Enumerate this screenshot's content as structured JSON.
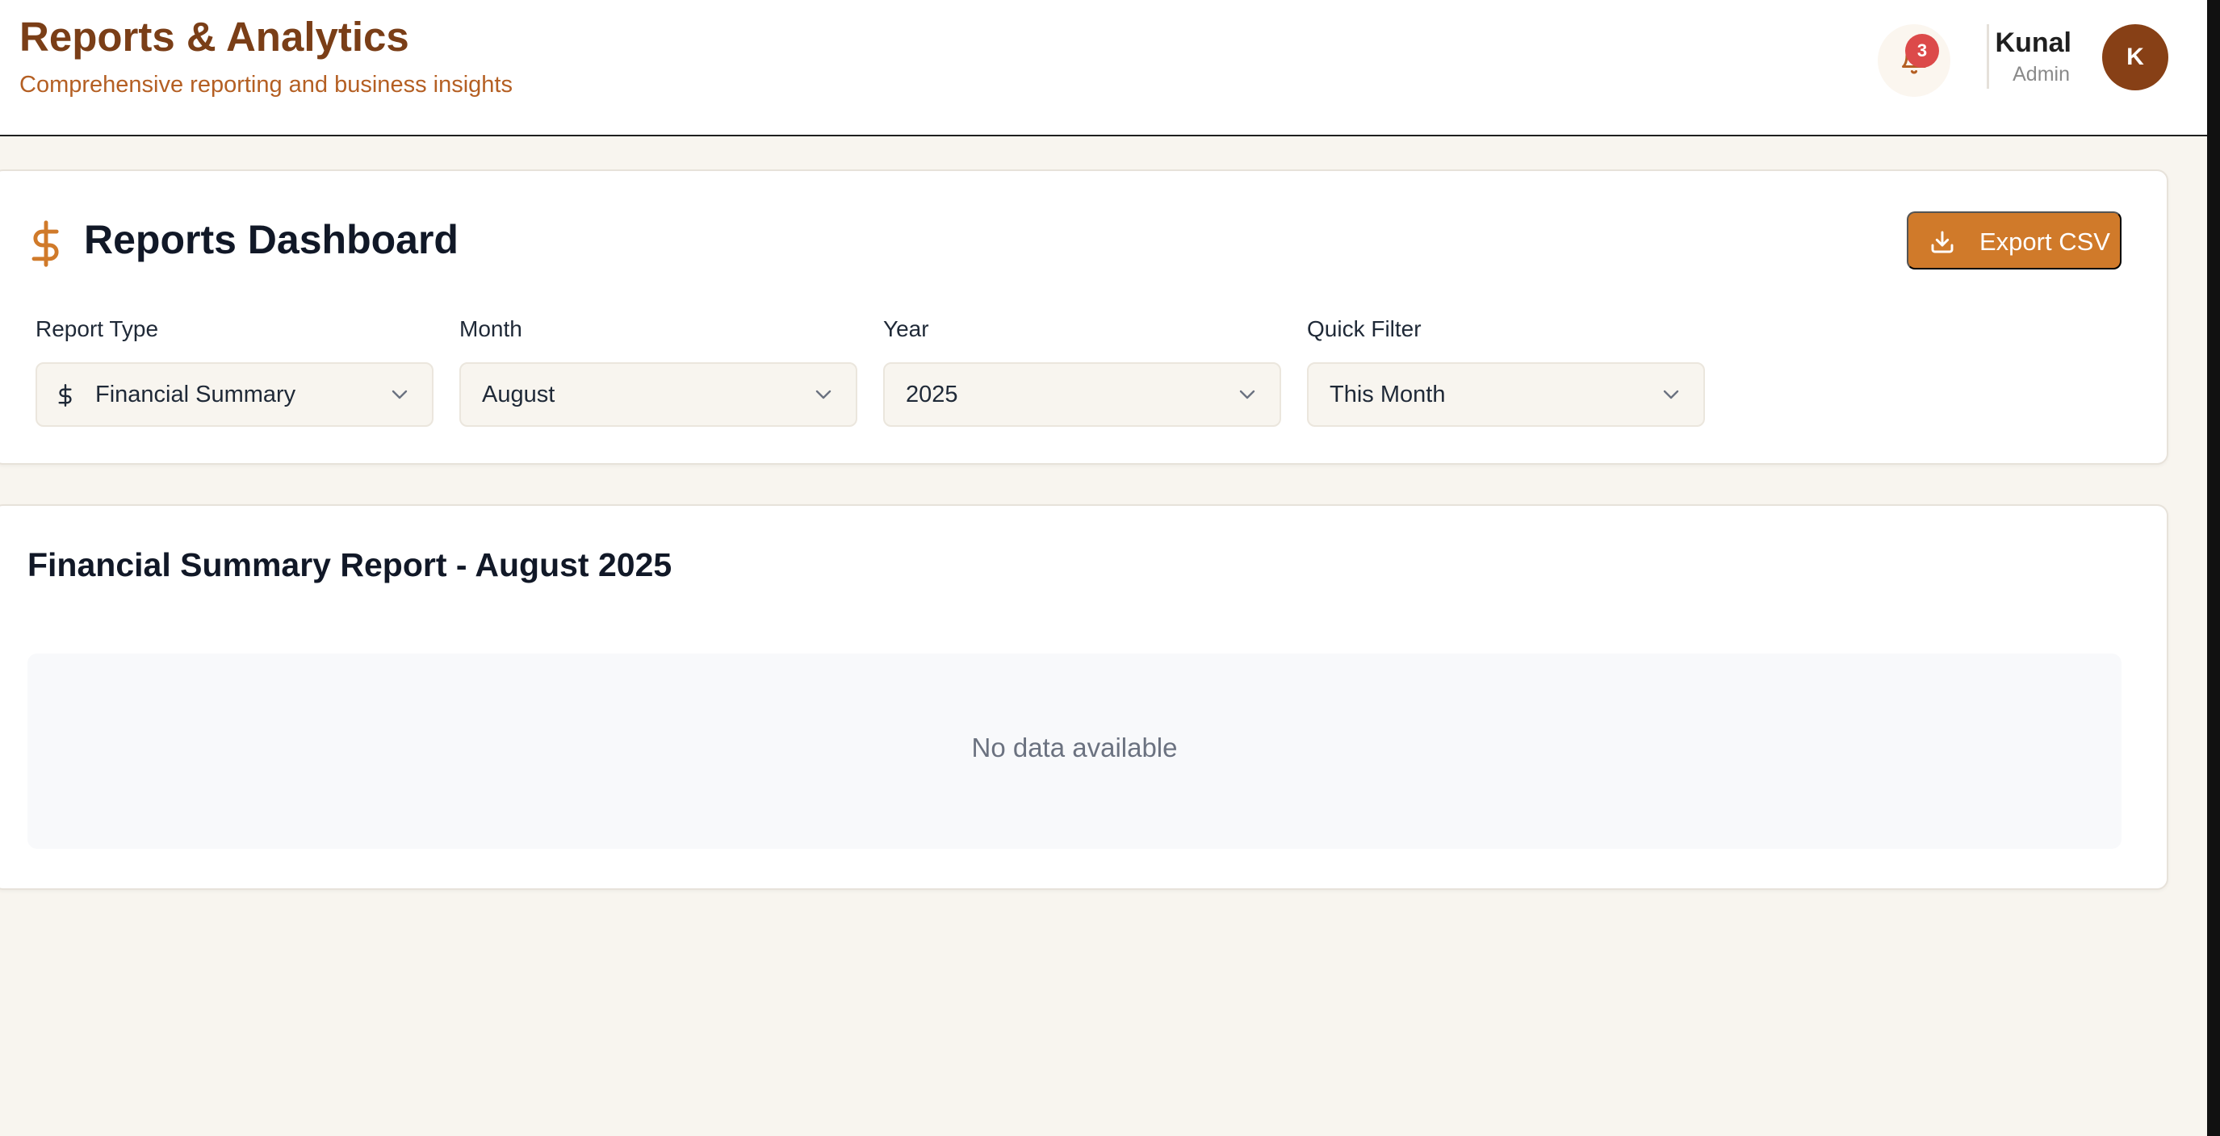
{
  "header": {
    "title": "Reports & Analytics",
    "subtitle": "Comprehensive reporting and business insights",
    "notifications": {
      "icon": "bell-icon",
      "count": "3"
    },
    "user": {
      "name": "Kunal",
      "role": "Admin",
      "initial": "K"
    }
  },
  "dashboard": {
    "icon": "dollar-icon",
    "title": "Reports Dashboard",
    "export_label": "Export CSV",
    "filters": {
      "report_type": {
        "label": "Report Type",
        "value": "Financial Summary",
        "icon": "dollar-icon"
      },
      "month": {
        "label": "Month",
        "value": "August"
      },
      "year": {
        "label": "Year",
        "value": "2025"
      },
      "quick_filter": {
        "label": "Quick Filter",
        "value": "This Month"
      }
    }
  },
  "report": {
    "title": "Financial Summary Report - August 2025",
    "empty_message": "No data available"
  },
  "colors": {
    "brand_dark": "#7a3e17",
    "brand_accent": "#d07a2a",
    "background": "#f8f5ef",
    "badge": "#dc4a4a",
    "avatar": "#874016"
  }
}
